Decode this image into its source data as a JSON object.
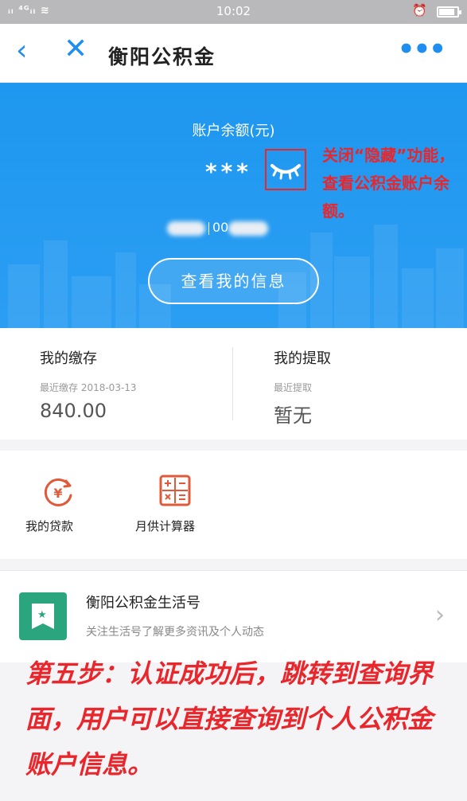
{
  "status_bar": {
    "signal_text": "ᵢₗ ⁴ᴳᵢₗ ≋",
    "time": "10:02",
    "alarm_icon": "alarm-icon",
    "battery_icon": "battery-icon"
  },
  "nav": {
    "back_icon": "chevron-left-icon",
    "close_icon": "close-icon",
    "title": "衡阳公积金",
    "more_icon": "more-dots-icon"
  },
  "hero": {
    "balance_label": "账户余额(元)",
    "balance_hidden": "***",
    "eye_icon": "eye-closed-icon",
    "account_number": "00",
    "button_label": "查看我的信息"
  },
  "annotations": {
    "top": "关闭“隐藏”功能，查看公积金账户余额。",
    "bottom": "第五步：认证成功后，跳转到查询界面，用户可以直接查询到个人公积金账户信息。"
  },
  "stats": {
    "deposit": {
      "title": "我的缴存",
      "sub": "最近缴存 2018-03-13",
      "value": "840.00"
    },
    "withdraw": {
      "title": "我的提取",
      "sub": "最近提取",
      "value": "暂无"
    }
  },
  "services": [
    {
      "label": "我的贷款",
      "icon": "loan-yuan-icon"
    },
    {
      "label": "月供计算器",
      "icon": "calculator-icon"
    }
  ],
  "life": {
    "title": "衡阳公积金生活号",
    "subtitle": "关注生活号了解更多资讯及个人动态",
    "icon": "bookmark-star-icon",
    "chevron_icon": "chevron-right-icon"
  },
  "colors": {
    "brand_blue": "#1e97f0",
    "annotation_red": "#e8262b",
    "loan_red": "#e05a3a",
    "life_green": "#2aa57e"
  }
}
